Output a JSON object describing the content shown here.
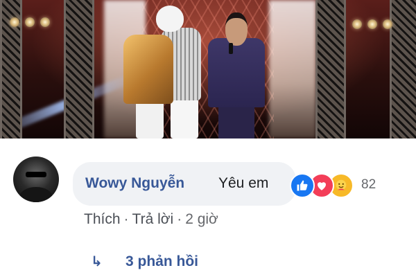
{
  "photo": {
    "description_icon": "stage-photo"
  },
  "comment": {
    "author": "Wowy Nguyễn",
    "text": "Yêu em",
    "reactions": {
      "icons": [
        "like-icon",
        "love-icon",
        "care-icon"
      ],
      "count": "82"
    },
    "actions": {
      "like": "Thích",
      "separator": "·",
      "reply": "Trả lời",
      "time": "2 giờ"
    },
    "replies": {
      "arrow": "↳",
      "label": "3 phản hồi"
    }
  },
  "colors": {
    "author_link": "#385898",
    "bubble_bg": "#f0f2f5",
    "meta_text": "#65676b",
    "like_blue": "#1877f2",
    "love_red": "#f33e58",
    "care_yellow": "#f7b928"
  }
}
